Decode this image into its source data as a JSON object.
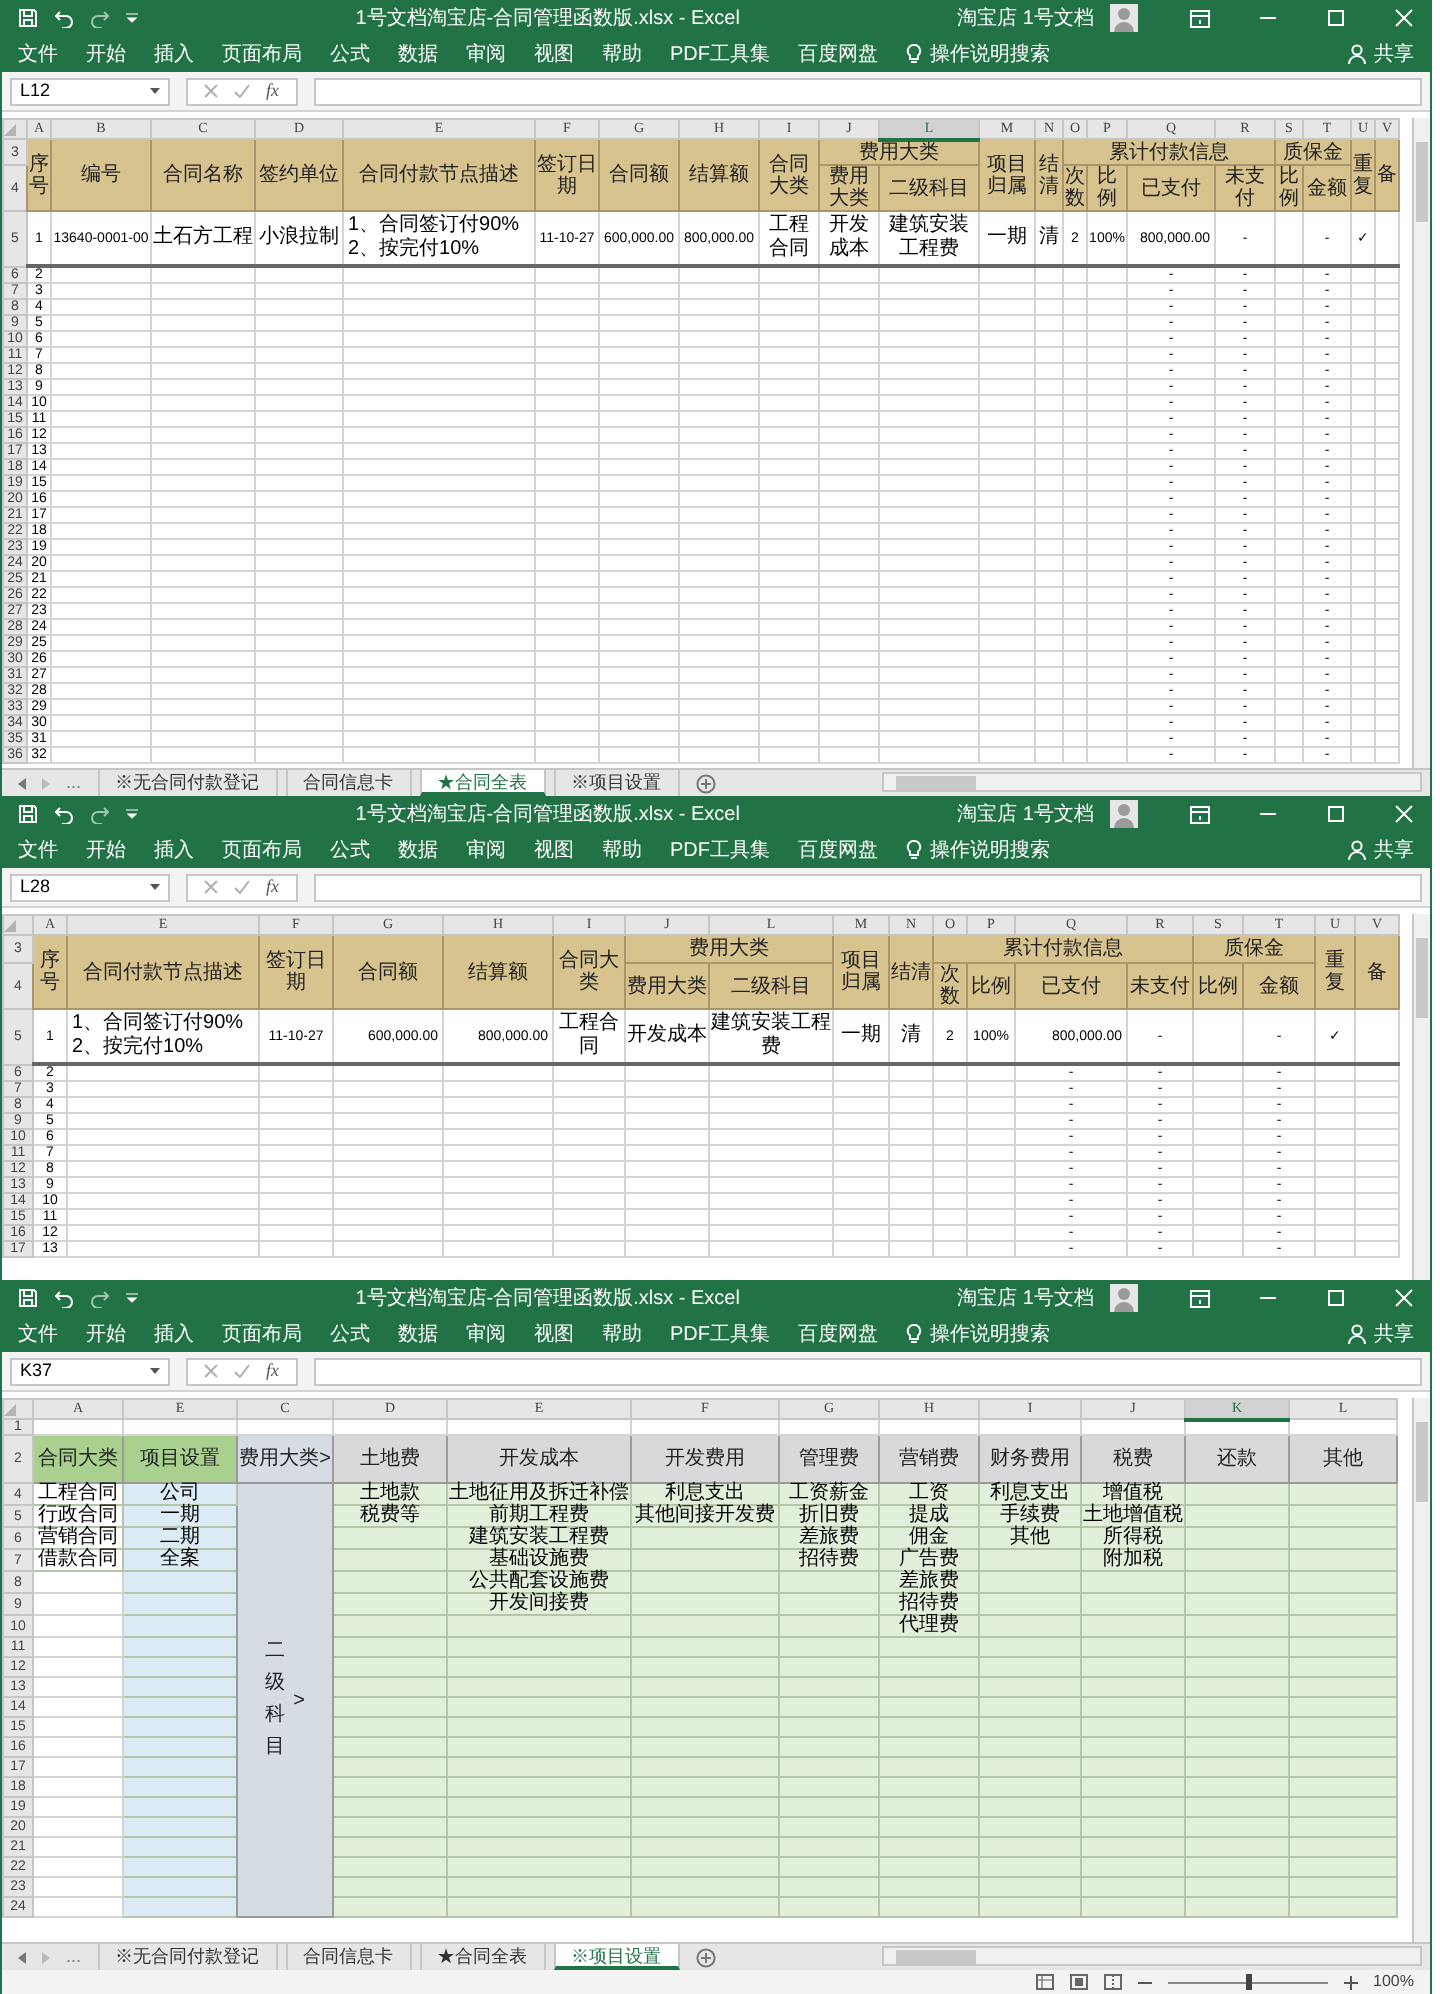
{
  "windows": [
    {
      "title": "1号文档淘宝店-合同管理函数版.xlsx - Excel",
      "account": "淘宝店 1号文档",
      "menu": [
        "文件",
        "开始",
        "插入",
        "页面布局",
        "公式",
        "数据",
        "审阅",
        "视图",
        "帮助",
        "PDF工具集",
        "百度网盘"
      ],
      "search": "操作说明搜索",
      "share": "共享",
      "name_box": "L12",
      "formula_label": "fx",
      "columns": [
        {
          "letter": "A",
          "selected": false
        },
        {
          "letter": "B",
          "selected": false
        },
        {
          "letter": "C",
          "selected": false
        },
        {
          "letter": "D",
          "selected": false
        },
        {
          "letter": "E",
          "selected": false
        },
        {
          "letter": "F",
          "selected": false
        },
        {
          "letter": "G",
          "selected": false
        },
        {
          "letter": "H",
          "selected": false
        },
        {
          "letter": "I",
          "selected": false
        },
        {
          "letter": "J",
          "selected": false
        },
        {
          "letter": "L",
          "selected": true
        },
        {
          "letter": "M",
          "selected": false
        },
        {
          "letter": "N",
          "selected": false
        },
        {
          "letter": "O",
          "selected": false
        },
        {
          "letter": "P",
          "selected": false
        },
        {
          "letter": "Q",
          "selected": false
        },
        {
          "letter": "R",
          "selected": false
        },
        {
          "letter": "S",
          "selected": false
        },
        {
          "letter": "T",
          "selected": false
        },
        {
          "letter": "U",
          "selected": false
        },
        {
          "letter": "V",
          "selected": false
        }
      ],
      "header_rows": [
        "3",
        "4"
      ],
      "headers": [
        {
          "label": "序号"
        },
        {
          "label": "编号"
        },
        {
          "label": "合同名称"
        },
        {
          "label": "签约单位"
        },
        {
          "label": "合同付款节点描述"
        },
        {
          "label": "签订日期"
        },
        {
          "label": "合同额"
        },
        {
          "label": "结算额"
        },
        {
          "label": "合同大类"
        },
        {
          "label": "费用大类",
          "sub": [
            "费用大类",
            "二级科目"
          ]
        },
        {
          "label": "项目归属"
        },
        {
          "label": "结清"
        },
        {
          "label": "累计付款信息",
          "sub": [
            "次数",
            "比例",
            "已支付",
            "未支付"
          ]
        },
        {
          "label": "质保金",
          "sub": [
            "比例",
            "金额"
          ]
        },
        {
          "label": "重复"
        },
        {
          "label": "备"
        }
      ],
      "rows": [
        {
          "num": "5",
          "cells": [
            "1",
            "13640-0001-00",
            "土石方工程",
            "小浪拉制",
            "1、合同签订付90%\n2、按完付10%",
            "11-10-27",
            "600,000.00",
            "800,000.00",
            "工程合同",
            "开发成本",
            "建筑安装工程费",
            "一期",
            "清",
            "2",
            "100%",
            "800,000.00",
            "-",
            null,
            "-",
            "✓",
            null
          ]
        },
        {
          "num": "6",
          "cells": [
            "2",
            null,
            null,
            null,
            null,
            null,
            null,
            null,
            null,
            null,
            null,
            null,
            null,
            null,
            null,
            "-",
            "-",
            null,
            "-",
            null,
            null
          ]
        },
        {
          "num": "7",
          "cells": [
            "3",
            null,
            null,
            null,
            null,
            null,
            null,
            null,
            null,
            null,
            null,
            null,
            null,
            null,
            null,
            "-",
            "-",
            null,
            "-",
            null,
            null
          ]
        },
        {
          "num": "8",
          "cells": [
            "4",
            null,
            null,
            null,
            null,
            null,
            null,
            null,
            null,
            null,
            null,
            null,
            null,
            null,
            null,
            "-",
            "-",
            null,
            "-",
            null,
            null
          ]
        },
        {
          "num": "9",
          "cells": [
            "5",
            null,
            null,
            null,
            null,
            null,
            null,
            null,
            null,
            null,
            null,
            null,
            null,
            null,
            null,
            "-",
            "-",
            null,
            "-",
            null,
            null
          ]
        },
        {
          "num": "10",
          "cells": [
            "6",
            null,
            null,
            null,
            null,
            null,
            null,
            null,
            null,
            null,
            null,
            null,
            null,
            null,
            null,
            "-",
            "-",
            null,
            "-",
            null,
            null
          ]
        },
        {
          "num": "11",
          "cells": [
            "7",
            null,
            null,
            null,
            null,
            null,
            null,
            null,
            null,
            null,
            null,
            null,
            null,
            null,
            null,
            "-",
            "-",
            null,
            "-",
            null,
            null
          ]
        },
        {
          "num": "12",
          "cells": [
            "8",
            null,
            null,
            null,
            null,
            null,
            null,
            null,
            null,
            null,
            null,
            null,
            null,
            null,
            null,
            "-",
            "-",
            null,
            "-",
            null,
            null
          ]
        },
        {
          "num": "13",
          "cells": [
            "9",
            null,
            null,
            null,
            null,
            null,
            null,
            null,
            null,
            null,
            null,
            null,
            null,
            null,
            null,
            "-",
            "-",
            null,
            "-",
            null,
            null
          ]
        },
        {
          "num": "14",
          "cells": [
            "10",
            null,
            null,
            null,
            null,
            null,
            null,
            null,
            null,
            null,
            null,
            null,
            null,
            null,
            null,
            "-",
            "-",
            null,
            "-",
            null,
            null
          ]
        },
        {
          "num": "15",
          "cells": [
            "11",
            null,
            null,
            null,
            null,
            null,
            null,
            null,
            null,
            null,
            null,
            null,
            null,
            null,
            null,
            "-",
            "-",
            null,
            "-",
            null,
            null
          ]
        },
        {
          "num": "16",
          "cells": [
            "12",
            null,
            null,
            null,
            null,
            null,
            null,
            null,
            null,
            null,
            null,
            null,
            null,
            null,
            null,
            "-",
            "-",
            null,
            "-",
            null,
            null
          ]
        },
        {
          "num": "17",
          "cells": [
            "13",
            null,
            null,
            null,
            null,
            null,
            null,
            null,
            null,
            null,
            null,
            null,
            null,
            null,
            null,
            "-",
            "-",
            null,
            "-",
            null,
            null
          ]
        },
        {
          "num": "18",
          "cells": [
            "14",
            null,
            null,
            null,
            null,
            null,
            null,
            null,
            null,
            null,
            null,
            null,
            null,
            null,
            null,
            "-",
            "-",
            null,
            "-",
            null,
            null
          ]
        },
        {
          "num": "19",
          "cells": [
            "15",
            null,
            null,
            null,
            null,
            null,
            null,
            null,
            null,
            null,
            null,
            null,
            null,
            null,
            null,
            "-",
            "-",
            null,
            "-",
            null,
            null
          ]
        },
        {
          "num": "20",
          "cells": [
            "16",
            null,
            null,
            null,
            null,
            null,
            null,
            null,
            null,
            null,
            null,
            null,
            null,
            null,
            null,
            "-",
            "-",
            null,
            "-",
            null,
            null
          ]
        },
        {
          "num": "21",
          "cells": [
            "17",
            null,
            null,
            null,
            null,
            null,
            null,
            null,
            null,
            null,
            null,
            null,
            null,
            null,
            null,
            "-",
            "-",
            null,
            "-",
            null,
            null
          ]
        },
        {
          "num": "22",
          "cells": [
            "18",
            null,
            null,
            null,
            null,
            null,
            null,
            null,
            null,
            null,
            null,
            null,
            null,
            null,
            null,
            "-",
            "-",
            null,
            "-",
            null,
            null
          ]
        },
        {
          "num": "23",
          "cells": [
            "19",
            null,
            null,
            null,
            null,
            null,
            null,
            null,
            null,
            null,
            null,
            null,
            null,
            null,
            null,
            "-",
            "-",
            null,
            "-",
            null,
            null
          ]
        },
        {
          "num": "24",
          "cells": [
            "20",
            null,
            null,
            null,
            null,
            null,
            null,
            null,
            null,
            null,
            null,
            null,
            null,
            null,
            null,
            "-",
            "-",
            null,
            "-",
            null,
            null
          ]
        },
        {
          "num": "25",
          "cells": [
            "21",
            null,
            null,
            null,
            null,
            null,
            null,
            null,
            null,
            null,
            null,
            null,
            null,
            null,
            null,
            "-",
            "-",
            null,
            "-",
            null,
            null
          ]
        },
        {
          "num": "26",
          "cells": [
            "22",
            null,
            null,
            null,
            null,
            null,
            null,
            null,
            null,
            null,
            null,
            null,
            null,
            null,
            null,
            "-",
            "-",
            null,
            "-",
            null,
            null
          ]
        },
        {
          "num": "27",
          "cells": [
            "23",
            null,
            null,
            null,
            null,
            null,
            null,
            null,
            null,
            null,
            null,
            null,
            null,
            null,
            null,
            "-",
            "-",
            null,
            "-",
            null,
            null
          ]
        },
        {
          "num": "28",
          "cells": [
            "24",
            null,
            null,
            null,
            null,
            null,
            null,
            null,
            null,
            null,
            null,
            null,
            null,
            null,
            null,
            "-",
            "-",
            null,
            "-",
            null,
            null
          ]
        },
        {
          "num": "29",
          "cells": [
            "25",
            null,
            null,
            null,
            null,
            null,
            null,
            null,
            null,
            null,
            null,
            null,
            null,
            null,
            null,
            "-",
            "-",
            null,
            "-",
            null,
            null
          ]
        },
        {
          "num": "30",
          "cells": [
            "26",
            null,
            null,
            null,
            null,
            null,
            null,
            null,
            null,
            null,
            null,
            null,
            null,
            null,
            null,
            "-",
            "-",
            null,
            "-",
            null,
            null
          ]
        },
        {
          "num": "31",
          "cells": [
            "27",
            null,
            null,
            null,
            null,
            null,
            null,
            null,
            null,
            null,
            null,
            null,
            null,
            null,
            null,
            "-",
            "-",
            null,
            "-",
            null,
            null
          ]
        },
        {
          "num": "32",
          "cells": [
            "28",
            null,
            null,
            null,
            null,
            null,
            null,
            null,
            null,
            null,
            null,
            null,
            null,
            null,
            null,
            "-",
            "-",
            null,
            "-",
            null,
            null
          ]
        },
        {
          "num": "33",
          "cells": [
            "29",
            null,
            null,
            null,
            null,
            null,
            null,
            null,
            null,
            null,
            null,
            null,
            null,
            null,
            null,
            "-",
            "-",
            null,
            "-",
            null,
            null
          ]
        },
        {
          "num": "34",
          "cells": [
            "30",
            null,
            null,
            null,
            null,
            null,
            null,
            null,
            null,
            null,
            null,
            null,
            null,
            null,
            null,
            "-",
            "-",
            null,
            "-",
            null,
            null
          ]
        },
        {
          "num": "35",
          "cells": [
            "31",
            null,
            null,
            null,
            null,
            null,
            null,
            null,
            null,
            null,
            null,
            null,
            null,
            null,
            null,
            "-",
            "-",
            null,
            "-",
            null,
            null
          ]
        },
        {
          "num": "36",
          "cells": [
            "32",
            null,
            null,
            null,
            null,
            null,
            null,
            null,
            null,
            null,
            null,
            null,
            null,
            null,
            null,
            "-",
            "-",
            null,
            "-",
            null,
            null
          ]
        }
      ],
      "tab_overflow": "...",
      "sheet_tabs": [
        {
          "label": "※无合同付款登记",
          "selected": false
        },
        {
          "label": "合同信息卡",
          "selected": false
        },
        {
          "label": "★合同全表",
          "selected": true
        },
        {
          "label": "※项目设置",
          "selected": false
        }
      ]
    },
    {
      "title": "1号文档淘宝店-合同管理函数版.xlsx - Excel",
      "account": "淘宝店 1号文档",
      "menu": [
        "文件",
        "开始",
        "插入",
        "页面布局",
        "公式",
        "数据",
        "审阅",
        "视图",
        "帮助",
        "PDF工具集",
        "百度网盘"
      ],
      "search": "操作说明搜索",
      "share": "共享",
      "name_box": "L28",
      "formula_label": "fx",
      "columns": [
        {
          "letter": "A",
          "selected": false
        },
        {
          "letter": "E",
          "selected": false
        },
        {
          "letter": "F",
          "selected": false
        },
        {
          "letter": "G",
          "selected": false
        },
        {
          "letter": "H",
          "selected": false
        },
        {
          "letter": "I",
          "selected": false
        },
        {
          "letter": "J",
          "selected": false
        },
        {
          "letter": "L",
          "selected": false
        },
        {
          "letter": "M",
          "selected": false
        },
        {
          "letter": "N",
          "selected": false
        },
        {
          "letter": "O",
          "selected": false
        },
        {
          "letter": "P",
          "selected": false
        },
        {
          "letter": "Q",
          "selected": false
        },
        {
          "letter": "R",
          "selected": false
        },
        {
          "letter": "S",
          "selected": false
        },
        {
          "letter": "T",
          "selected": false
        },
        {
          "letter": "U",
          "selected": false
        },
        {
          "letter": "V",
          "selected": false
        }
      ],
      "header_rows": [
        "3",
        "4"
      ],
      "headers": [
        {
          "label": "序号"
        },
        {
          "label": "合同付款节点描述"
        },
        {
          "label": "签订日期"
        },
        {
          "label": "合同额"
        },
        {
          "label": "结算额"
        },
        {
          "label": "合同大类"
        },
        {
          "label": "费用大类",
          "sub": [
            "费用大类",
            "二级科目"
          ]
        },
        {
          "label": "项目归属"
        },
        {
          "label": "结清"
        },
        {
          "label": "累计付款信息",
          "sub": [
            "次数",
            "比例",
            "已支付",
            "未支付"
          ]
        },
        {
          "label": "质保金",
          "sub": [
            "比例",
            "金额"
          ]
        },
        {
          "label": "重复"
        },
        {
          "label": "备"
        }
      ],
      "rows": [
        {
          "num": "5",
          "cells": [
            "1",
            "1、合同签订付90%\n2、按完付10%",
            "11-10-27",
            "600,000.00",
            "800,000.00",
            "工程合同",
            "开发成本",
            "建筑安装工程费",
            "一期",
            "清",
            "2",
            "100%",
            "800,000.00",
            "-",
            null,
            "-",
            "✓",
            null
          ]
        },
        {
          "num": "6",
          "cells": [
            "2",
            null,
            null,
            null,
            null,
            null,
            null,
            null,
            null,
            null,
            null,
            null,
            "-",
            "-",
            null,
            "-",
            null,
            null
          ]
        },
        {
          "num": "7",
          "cells": [
            "3",
            null,
            null,
            null,
            null,
            null,
            null,
            null,
            null,
            null,
            null,
            null,
            "-",
            "-",
            null,
            "-",
            null,
            null
          ]
        },
        {
          "num": "8",
          "cells": [
            "4",
            null,
            null,
            null,
            null,
            null,
            null,
            null,
            null,
            null,
            null,
            null,
            "-",
            "-",
            null,
            "-",
            null,
            null
          ]
        },
        {
          "num": "9",
          "cells": [
            "5",
            null,
            null,
            null,
            null,
            null,
            null,
            null,
            null,
            null,
            null,
            null,
            "-",
            "-",
            null,
            "-",
            null,
            null
          ]
        },
        {
          "num": "10",
          "cells": [
            "6",
            null,
            null,
            null,
            null,
            null,
            null,
            null,
            null,
            null,
            null,
            null,
            "-",
            "-",
            null,
            "-",
            null,
            null
          ]
        },
        {
          "num": "11",
          "cells": [
            "7",
            null,
            null,
            null,
            null,
            null,
            null,
            null,
            null,
            null,
            null,
            null,
            "-",
            "-",
            null,
            "-",
            null,
            null
          ]
        },
        {
          "num": "12",
          "cells": [
            "8",
            null,
            null,
            null,
            null,
            null,
            null,
            null,
            null,
            null,
            null,
            null,
            "-",
            "-",
            null,
            "-",
            null,
            null
          ]
        },
        {
          "num": "13",
          "cells": [
            "9",
            null,
            null,
            null,
            null,
            null,
            null,
            null,
            null,
            null,
            null,
            null,
            "-",
            "-",
            null,
            "-",
            null,
            null
          ]
        },
        {
          "num": "14",
          "cells": [
            "10",
            null,
            null,
            null,
            null,
            null,
            null,
            null,
            null,
            null,
            null,
            null,
            "-",
            "-",
            null,
            "-",
            null,
            null
          ]
        },
        {
          "num": "15",
          "cells": [
            "11",
            null,
            null,
            null,
            null,
            null,
            null,
            null,
            null,
            null,
            null,
            null,
            "-",
            "-",
            null,
            "-",
            null,
            null
          ]
        },
        {
          "num": "16",
          "cells": [
            "12",
            null,
            null,
            null,
            null,
            null,
            null,
            null,
            null,
            null,
            null,
            null,
            "-",
            "-",
            null,
            "-",
            null,
            null
          ]
        },
        {
          "num": "17",
          "cells": [
            "13",
            null,
            null,
            null,
            null,
            null,
            null,
            null,
            null,
            null,
            null,
            null,
            "-",
            "-",
            null,
            "-",
            null,
            null
          ]
        }
      ]
    },
    {
      "title": "1号文档淘宝店-合同管理函数版.xlsx - Excel",
      "account": "淘宝店 1号文档",
      "menu": [
        "文件",
        "开始",
        "插入",
        "页面布局",
        "公式",
        "数据",
        "审阅",
        "视图",
        "帮助",
        "PDF工具集",
        "百度网盘"
      ],
      "search": "操作说明搜索",
      "share": "共享",
      "name_box": "K37",
      "formula_label": "fx",
      "columns": [
        {
          "letter": "A",
          "selected": false
        },
        {
          "letter": "E",
          "selected": false
        },
        {
          "letter": "C",
          "selected": false
        },
        {
          "letter": "D",
          "selected": false
        },
        {
          "letter": "E",
          "selected": false
        },
        {
          "letter": "F",
          "selected": false
        },
        {
          "letter": "G",
          "selected": false
        },
        {
          "letter": "H",
          "selected": false
        },
        {
          "letter": "I",
          "selected": false
        },
        {
          "letter": "J",
          "selected": false
        },
        {
          "letter": "K",
          "selected": true
        },
        {
          "letter": "L",
          "selected": false
        }
      ],
      "top_row": "1",
      "header_row": "2",
      "headers": [
        {
          "label": "合同大类"
        },
        {
          "label": "项目设置"
        },
        {
          "label": "费用大类>"
        },
        {
          "label": "土地费"
        },
        {
          "label": "开发成本"
        },
        {
          "label": "开发费用"
        },
        {
          "label": "管理费"
        },
        {
          "label": "营销费"
        },
        {
          "label": "财务费用"
        },
        {
          "label": "税费"
        },
        {
          "label": "还款"
        },
        {
          "label": "其他"
        }
      ],
      "side_label": {
        "text": "二级科目",
        "arrow": ">"
      },
      "rows": [
        {
          "num": "4",
          "cells": [
            "工程合同",
            "公司",
            null,
            "土地款",
            "土地征用及拆迁补偿",
            "利息支出",
            "工资薪金",
            "工资",
            "利息支出",
            "增值税",
            null,
            null
          ]
        },
        {
          "num": "5",
          "cells": [
            "行政合同",
            "一期",
            null,
            "税费等",
            "前期工程费",
            "其他间接开发费",
            "折旧费",
            "提成",
            "手续费",
            "土地增值税",
            null,
            null
          ]
        },
        {
          "num": "6",
          "cells": [
            "营销合同",
            "二期",
            null,
            null,
            "建筑安装工程费",
            null,
            "差旅费",
            "佣金",
            "其他",
            "所得税",
            null,
            null
          ]
        },
        {
          "num": "7",
          "cells": [
            "借款合同",
            "全案",
            null,
            null,
            "基础设施费",
            null,
            "招待费",
            "广告费",
            null,
            "附加税",
            null,
            null
          ]
        },
        {
          "num": "8",
          "cells": [
            null,
            null,
            null,
            null,
            "公共配套设施费",
            null,
            null,
            "差旅费",
            null,
            null,
            null,
            null
          ]
        },
        {
          "num": "9",
          "cells": [
            null,
            null,
            null,
            null,
            "开发间接费",
            null,
            null,
            "招待费",
            null,
            null,
            null,
            null
          ]
        },
        {
          "num": "10",
          "cells": [
            null,
            null,
            null,
            null,
            null,
            null,
            null,
            "代理费",
            null,
            null,
            null,
            null
          ]
        },
        {
          "num": "11"
        },
        {
          "num": "12"
        },
        {
          "num": "13"
        },
        {
          "num": "14"
        },
        {
          "num": "15"
        },
        {
          "num": "16"
        },
        {
          "num": "17"
        },
        {
          "num": "18"
        },
        {
          "num": "19"
        },
        {
          "num": "20"
        },
        {
          "num": "21"
        },
        {
          "num": "22"
        },
        {
          "num": "23"
        },
        {
          "num": "24"
        }
      ],
      "tab_overflow": "...",
      "sheet_tabs": [
        {
          "label": "※无合同付款登记",
          "selected": false
        },
        {
          "label": "合同信息卡",
          "selected": false
        },
        {
          "label": "★合同全表",
          "selected": false
        },
        {
          "label": "※项目设置",
          "selected": true
        }
      ],
      "zoom": {
        "level": 0.5,
        "reading": "100%"
      }
    }
  ]
}
